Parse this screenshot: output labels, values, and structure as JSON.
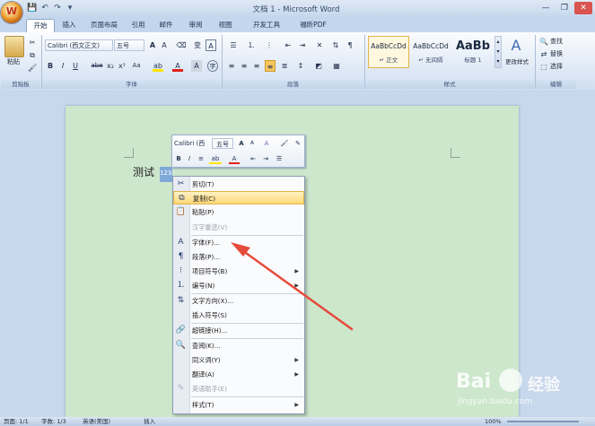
{
  "window": {
    "title": "文档 1 - Microsoft Word",
    "office_button": "W",
    "controls": {
      "minimize": "—",
      "restore": "❐",
      "close": "✕"
    }
  },
  "qat": {
    "save": "💾",
    "undo": "↶",
    "redo": "↷",
    "customize": "▾"
  },
  "tabs": [
    {
      "label": "开始",
      "active": true
    },
    {
      "label": "插入"
    },
    {
      "label": "页面布局"
    },
    {
      "label": "引用"
    },
    {
      "label": "邮件"
    },
    {
      "label": "审阅"
    },
    {
      "label": "视图"
    },
    {
      "label": "开发工具"
    },
    {
      "label": "福昕PDF"
    }
  ],
  "ribbon": {
    "clipboard": {
      "paste": "粘贴",
      "group": "剪贴板"
    },
    "font": {
      "font_name": "Calibri (西文正文)",
      "font_size": "五号",
      "group": "字体",
      "bold": "B",
      "italic": "I",
      "underline": "U",
      "strike": "abe",
      "sub": "x₂",
      "sup": "x²",
      "aa": "Aa",
      "color_a": "A"
    },
    "paragraph": {
      "group": "段落"
    },
    "styles": {
      "group": "样式",
      "items": [
        {
          "sample": "AaBbCcDd",
          "name": "↵ 正文"
        },
        {
          "sample": "AaBbCcDd",
          "name": "↵ 无间隔"
        },
        {
          "sample": "AaBb",
          "name": "标题 1"
        }
      ],
      "change": "更改样式"
    },
    "editing": {
      "group": "编辑",
      "find": "查找",
      "replace": "替换",
      "select": "选择"
    }
  },
  "document": {
    "text": "测试",
    "selected": "123"
  },
  "mini_toolbar": {
    "font_name": "Calibri (西",
    "font_size": "五号",
    "grow": "A",
    "shrink": "A",
    "bold": "B",
    "italic": "I",
    "center": "≡",
    "highlight": "ab",
    "color": "A",
    "indent_dec": "⇤",
    "indent_inc": "⇥",
    "list": "☰"
  },
  "context_menu": [
    {
      "label": "剪切(T)",
      "icon": "✂"
    },
    {
      "label": "复制(C)",
      "icon": "⧉",
      "highlighted": true
    },
    {
      "label": "粘贴(P)",
      "icon": "📋"
    },
    {
      "label": "汉字重选(V)",
      "disabled": true
    },
    {
      "separator": true
    },
    {
      "label": "字体(F)...",
      "icon": "A"
    },
    {
      "label": "段落(P)...",
      "icon": "¶"
    },
    {
      "label": "项目符号(B)",
      "icon": "⁝",
      "submenu": true
    },
    {
      "label": "编号(N)",
      "icon": "⒈",
      "submenu": true
    },
    {
      "separator": true
    },
    {
      "label": "文字方向(X)...",
      "icon": "⇅"
    },
    {
      "label": "插入符号(S)"
    },
    {
      "separator": true
    },
    {
      "label": "超链接(H)...",
      "icon": "🔗"
    },
    {
      "separator": true
    },
    {
      "label": "查阅(K)...",
      "icon": "🔍"
    },
    {
      "label": "同义词(Y)",
      "submenu": true
    },
    {
      "label": "翻译(A)",
      "submenu": true
    },
    {
      "label": "英语助手(E)",
      "icon": "✎",
      "disabled": true
    },
    {
      "separator": true
    },
    {
      "label": "样式(T)",
      "submenu": true
    }
  ],
  "status_bar": {
    "page": "页面: 1/1",
    "words": "字数: 1/3",
    "language": "英语(美国)",
    "insert": "插入",
    "zoom": "100%"
  },
  "watermark": {
    "brand": "Bai",
    "brand2": "经验",
    "url": "jingyan.baidu.com"
  },
  "colors": {
    "accent": "#e64b3c",
    "page": "#cde7cd",
    "ribbon": "#dde8f5",
    "highlight": "#ffd978"
  }
}
